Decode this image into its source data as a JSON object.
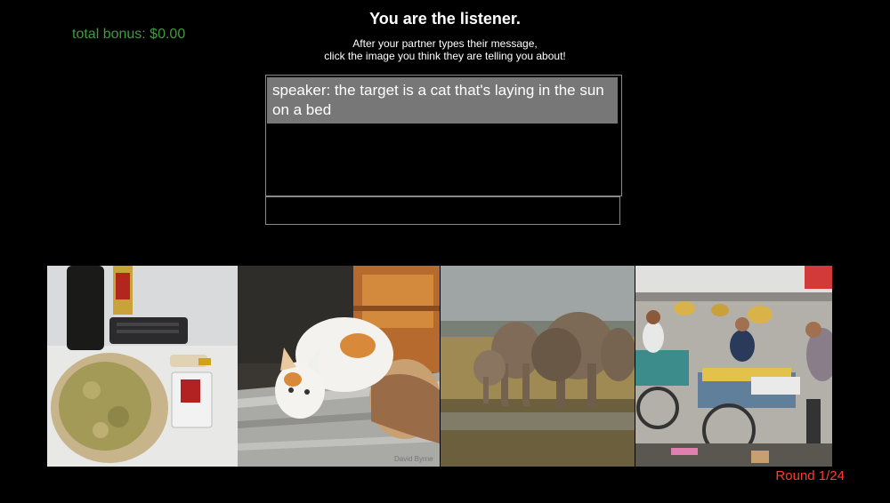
{
  "header": {
    "bonus": "total bonus: $0.00",
    "title": "You are the listener.",
    "instructions": [
      "After your partner types their message,",
      "click the image you think they are telling you about!"
    ]
  },
  "chat": {
    "messages": [
      {
        "text": "speaker: the target is a cat that's laying in the sun on a bed"
      }
    ],
    "input_value": ""
  },
  "images": [
    {
      "name": "image-food-table",
      "watermark": ""
    },
    {
      "name": "image-cat-bed",
      "watermark": "David Byrne"
    },
    {
      "name": "image-elephants",
      "watermark": ""
    },
    {
      "name": "image-street-market",
      "watermark": ""
    }
  ],
  "footer": {
    "round": "Round 1/24"
  },
  "colors": {
    "bonus": "#3f9b3f",
    "round": "#ff3b30",
    "message_bg": "#777777"
  }
}
